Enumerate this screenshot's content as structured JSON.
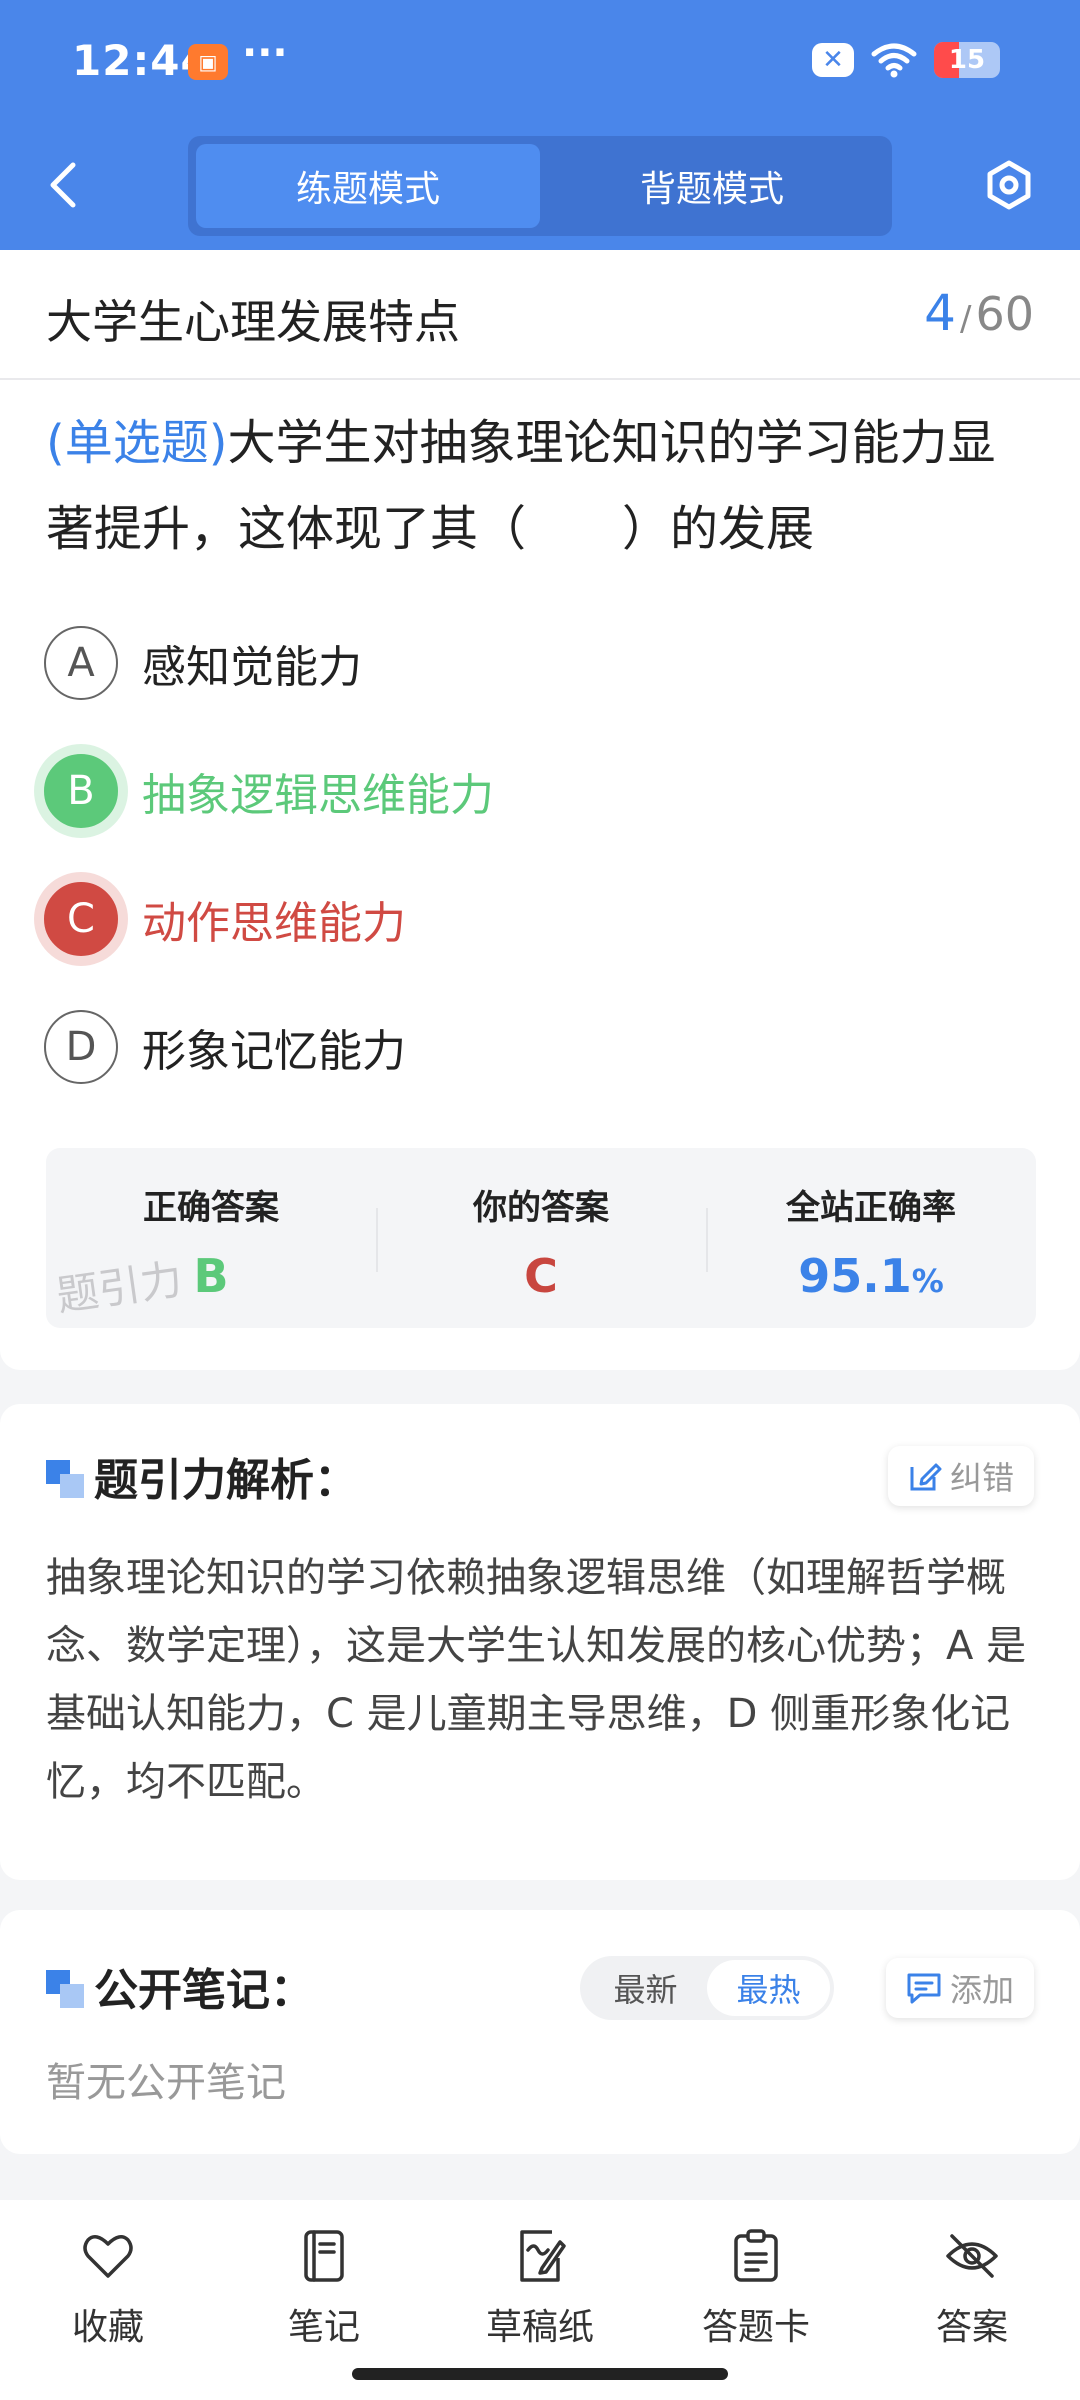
{
  "status_bar": {
    "time": "12:44",
    "more": "···",
    "battery": "15"
  },
  "header": {
    "modes": [
      "练题模式",
      "背题模式"
    ],
    "active_mode": "练题模式"
  },
  "topic": {
    "title": "大学生心理发展特点",
    "current": "4",
    "total": "60",
    "sep": "/"
  },
  "question": {
    "type": "(单选题)",
    "text": "大学生对抽象理论知识的学习能力显著提升，这体现了其（　　）的发展",
    "options": [
      {
        "letter": "A",
        "label": "感知觉能力",
        "state": "normal"
      },
      {
        "letter": "B",
        "label": "抽象逻辑思维能力",
        "state": "correct"
      },
      {
        "letter": "C",
        "label": "动作思维能力",
        "state": "wrong"
      },
      {
        "letter": "D",
        "label": "形象记忆能力",
        "state": "normal"
      }
    ]
  },
  "answer_panel": {
    "correct_label": "正确答案",
    "correct_value": "B",
    "yours_label": "你的答案",
    "yours_value": "C",
    "rate_label": "全站正确率",
    "rate_value": "95.1",
    "rate_unit": "%",
    "watermark": "题引力"
  },
  "analysis": {
    "title": "题引力解析：",
    "report_label": "纠错",
    "text": "抽象理论知识的学习依赖抽象逻辑思维（如理解哲学概念、数学定理），这是大学生认知发展的核心优势；A 是基础认知能力，C 是儿童期主导思维，D 侧重形象化记忆，均不匹配。"
  },
  "notes": {
    "title": "公开笔记：",
    "sort_options": [
      "最新",
      "最热"
    ],
    "active_sort": "最热",
    "add_label": "添加",
    "empty": "暂无公开笔记"
  },
  "bottom_tabs": [
    {
      "label": "收藏",
      "icon": "heart-icon"
    },
    {
      "label": "笔记",
      "icon": "notebook-icon"
    },
    {
      "label": "草稿纸",
      "icon": "draft-icon"
    },
    {
      "label": "答题卡",
      "icon": "clipboard-icon"
    },
    {
      "label": "答案",
      "icon": "eye-off-icon"
    }
  ],
  "colors": {
    "primary": "#4a86ea",
    "correct": "#5cc97a",
    "wrong": "#d04a43",
    "accent_text": "#3b82e8"
  }
}
